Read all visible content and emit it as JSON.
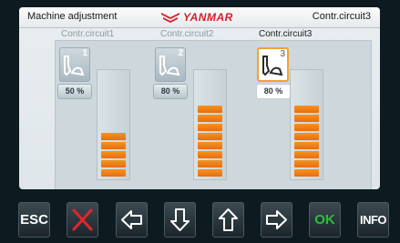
{
  "header": {
    "title": "Machine adjustment",
    "brand": "YANMAR",
    "right": "Contr.circuit3"
  },
  "circuits": [
    {
      "label": "Contr.circuit1",
      "number": "1",
      "percent_text": "50 %",
      "level_segments": 5
    },
    {
      "label": "Contr.circuit2",
      "number": "2",
      "percent_text": "80 %",
      "level_segments": 8
    },
    {
      "label": "Contr.circuit3",
      "number": "3",
      "percent_text": "80 %",
      "level_segments": 8,
      "selected": true
    }
  ],
  "softkeys": {
    "esc": "ESC",
    "cancel_icon": "x-icon",
    "left_icon": "arrow-left-icon",
    "down_icon": "arrow-down-icon",
    "up_icon": "arrow-up-icon",
    "right_icon": "arrow-right-icon",
    "ok": "OK",
    "info": "INFO"
  },
  "colors": {
    "accent": "#f7931e",
    "selected_border": "#f0a22d",
    "brand": "#d4202a",
    "ok": "#2fbf3a",
    "cancel": "#e0262d"
  }
}
